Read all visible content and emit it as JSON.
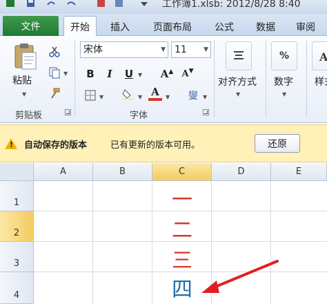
{
  "title": {
    "text": "工作簿1.xlsb: 2012/8/28 8:40"
  },
  "tabs": {
    "file": "文件",
    "items": [
      "开始",
      "插入",
      "页面布局",
      "公式",
      "数据",
      "审阅"
    ]
  },
  "ribbon": {
    "clipboard": {
      "paste_label": "粘贴",
      "group_label": "剪贴板"
    },
    "font": {
      "font_name": "宋体",
      "font_size": "11",
      "bold": "B",
      "italic": "I",
      "underline": "U",
      "grow": "A",
      "shrink": "A",
      "font_color": "A",
      "phonetic": "燮",
      "group_label": "字体"
    },
    "alignment": {
      "label": "对齐方式"
    },
    "number": {
      "label": "数字",
      "symbol": "%"
    },
    "styles": {
      "label": "样式"
    }
  },
  "infobar": {
    "title": "自动保存的版本",
    "message": "已有更新的版本可用。",
    "button": "还原"
  },
  "sheet": {
    "columns": [
      "A",
      "B",
      "C",
      "D",
      "E"
    ],
    "rows": [
      "1",
      "2",
      "3",
      "4"
    ],
    "selected_column": "C",
    "selected_row": "2",
    "cells": {
      "C1": "一",
      "C2": "二",
      "C3": "三",
      "C4": "四"
    }
  },
  "colors": {
    "file_tab": "#2a8a3e",
    "red_text": "#d9342b",
    "blue_text": "#1f6fb0",
    "arrow": "#e02020",
    "infobar_bg": "#fff1b8"
  }
}
